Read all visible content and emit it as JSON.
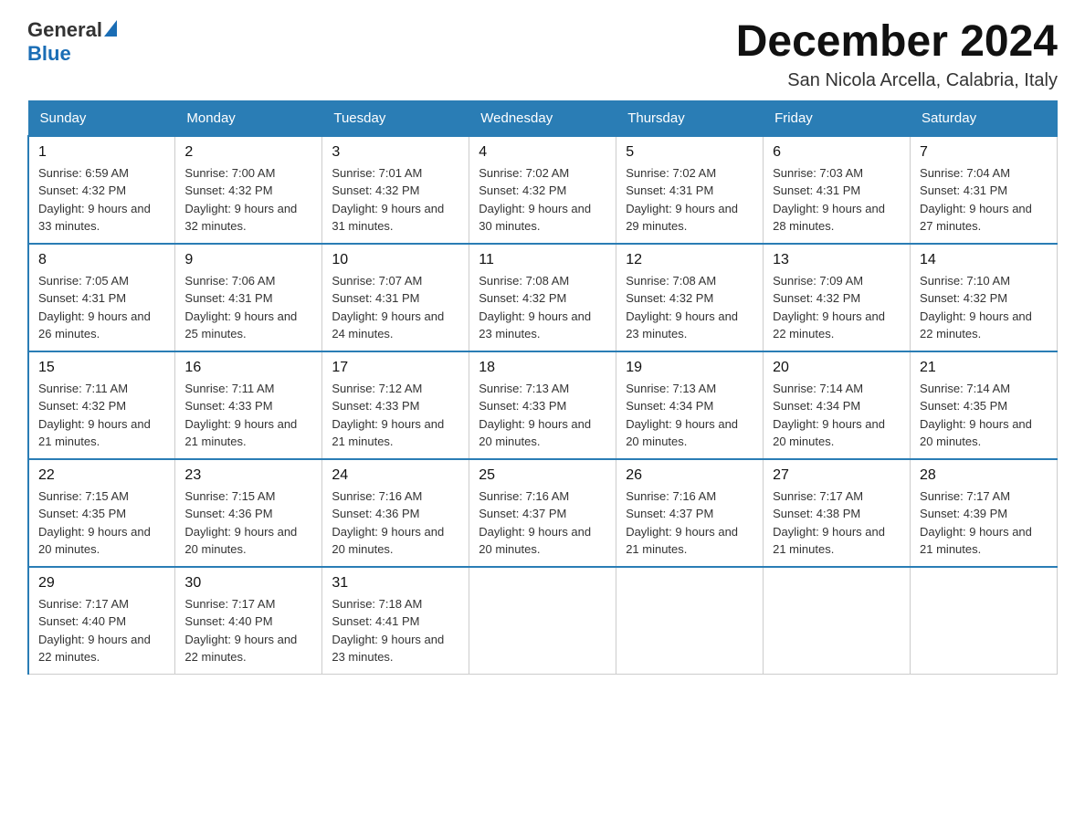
{
  "logo": {
    "text_general": "General",
    "text_blue": "Blue"
  },
  "title": "December 2024",
  "subtitle": "San Nicola Arcella, Calabria, Italy",
  "days_of_week": [
    "Sunday",
    "Monday",
    "Tuesday",
    "Wednesday",
    "Thursday",
    "Friday",
    "Saturday"
  ],
  "weeks": [
    [
      {
        "day": "1",
        "sunrise": "6:59 AM",
        "sunset": "4:32 PM",
        "daylight": "9 hours and 33 minutes."
      },
      {
        "day": "2",
        "sunrise": "7:00 AM",
        "sunset": "4:32 PM",
        "daylight": "9 hours and 32 minutes."
      },
      {
        "day": "3",
        "sunrise": "7:01 AM",
        "sunset": "4:32 PM",
        "daylight": "9 hours and 31 minutes."
      },
      {
        "day": "4",
        "sunrise": "7:02 AM",
        "sunset": "4:32 PM",
        "daylight": "9 hours and 30 minutes."
      },
      {
        "day": "5",
        "sunrise": "7:02 AM",
        "sunset": "4:31 PM",
        "daylight": "9 hours and 29 minutes."
      },
      {
        "day": "6",
        "sunrise": "7:03 AM",
        "sunset": "4:31 PM",
        "daylight": "9 hours and 28 minutes."
      },
      {
        "day": "7",
        "sunrise": "7:04 AM",
        "sunset": "4:31 PM",
        "daylight": "9 hours and 27 minutes."
      }
    ],
    [
      {
        "day": "8",
        "sunrise": "7:05 AM",
        "sunset": "4:31 PM",
        "daylight": "9 hours and 26 minutes."
      },
      {
        "day": "9",
        "sunrise": "7:06 AM",
        "sunset": "4:31 PM",
        "daylight": "9 hours and 25 minutes."
      },
      {
        "day": "10",
        "sunrise": "7:07 AM",
        "sunset": "4:31 PM",
        "daylight": "9 hours and 24 minutes."
      },
      {
        "day": "11",
        "sunrise": "7:08 AM",
        "sunset": "4:32 PM",
        "daylight": "9 hours and 23 minutes."
      },
      {
        "day": "12",
        "sunrise": "7:08 AM",
        "sunset": "4:32 PM",
        "daylight": "9 hours and 23 minutes."
      },
      {
        "day": "13",
        "sunrise": "7:09 AM",
        "sunset": "4:32 PM",
        "daylight": "9 hours and 22 minutes."
      },
      {
        "day": "14",
        "sunrise": "7:10 AM",
        "sunset": "4:32 PM",
        "daylight": "9 hours and 22 minutes."
      }
    ],
    [
      {
        "day": "15",
        "sunrise": "7:11 AM",
        "sunset": "4:32 PM",
        "daylight": "9 hours and 21 minutes."
      },
      {
        "day": "16",
        "sunrise": "7:11 AM",
        "sunset": "4:33 PM",
        "daylight": "9 hours and 21 minutes."
      },
      {
        "day": "17",
        "sunrise": "7:12 AM",
        "sunset": "4:33 PM",
        "daylight": "9 hours and 21 minutes."
      },
      {
        "day": "18",
        "sunrise": "7:13 AM",
        "sunset": "4:33 PM",
        "daylight": "9 hours and 20 minutes."
      },
      {
        "day": "19",
        "sunrise": "7:13 AM",
        "sunset": "4:34 PM",
        "daylight": "9 hours and 20 minutes."
      },
      {
        "day": "20",
        "sunrise": "7:14 AM",
        "sunset": "4:34 PM",
        "daylight": "9 hours and 20 minutes."
      },
      {
        "day": "21",
        "sunrise": "7:14 AM",
        "sunset": "4:35 PM",
        "daylight": "9 hours and 20 minutes."
      }
    ],
    [
      {
        "day": "22",
        "sunrise": "7:15 AM",
        "sunset": "4:35 PM",
        "daylight": "9 hours and 20 minutes."
      },
      {
        "day": "23",
        "sunrise": "7:15 AM",
        "sunset": "4:36 PM",
        "daylight": "9 hours and 20 minutes."
      },
      {
        "day": "24",
        "sunrise": "7:16 AM",
        "sunset": "4:36 PM",
        "daylight": "9 hours and 20 minutes."
      },
      {
        "day": "25",
        "sunrise": "7:16 AM",
        "sunset": "4:37 PM",
        "daylight": "9 hours and 20 minutes."
      },
      {
        "day": "26",
        "sunrise": "7:16 AM",
        "sunset": "4:37 PM",
        "daylight": "9 hours and 21 minutes."
      },
      {
        "day": "27",
        "sunrise": "7:17 AM",
        "sunset": "4:38 PM",
        "daylight": "9 hours and 21 minutes."
      },
      {
        "day": "28",
        "sunrise": "7:17 AM",
        "sunset": "4:39 PM",
        "daylight": "9 hours and 21 minutes."
      }
    ],
    [
      {
        "day": "29",
        "sunrise": "7:17 AM",
        "sunset": "4:40 PM",
        "daylight": "9 hours and 22 minutes."
      },
      {
        "day": "30",
        "sunrise": "7:17 AM",
        "sunset": "4:40 PM",
        "daylight": "9 hours and 22 minutes."
      },
      {
        "day": "31",
        "sunrise": "7:18 AM",
        "sunset": "4:41 PM",
        "daylight": "9 hours and 23 minutes."
      },
      null,
      null,
      null,
      null
    ]
  ]
}
